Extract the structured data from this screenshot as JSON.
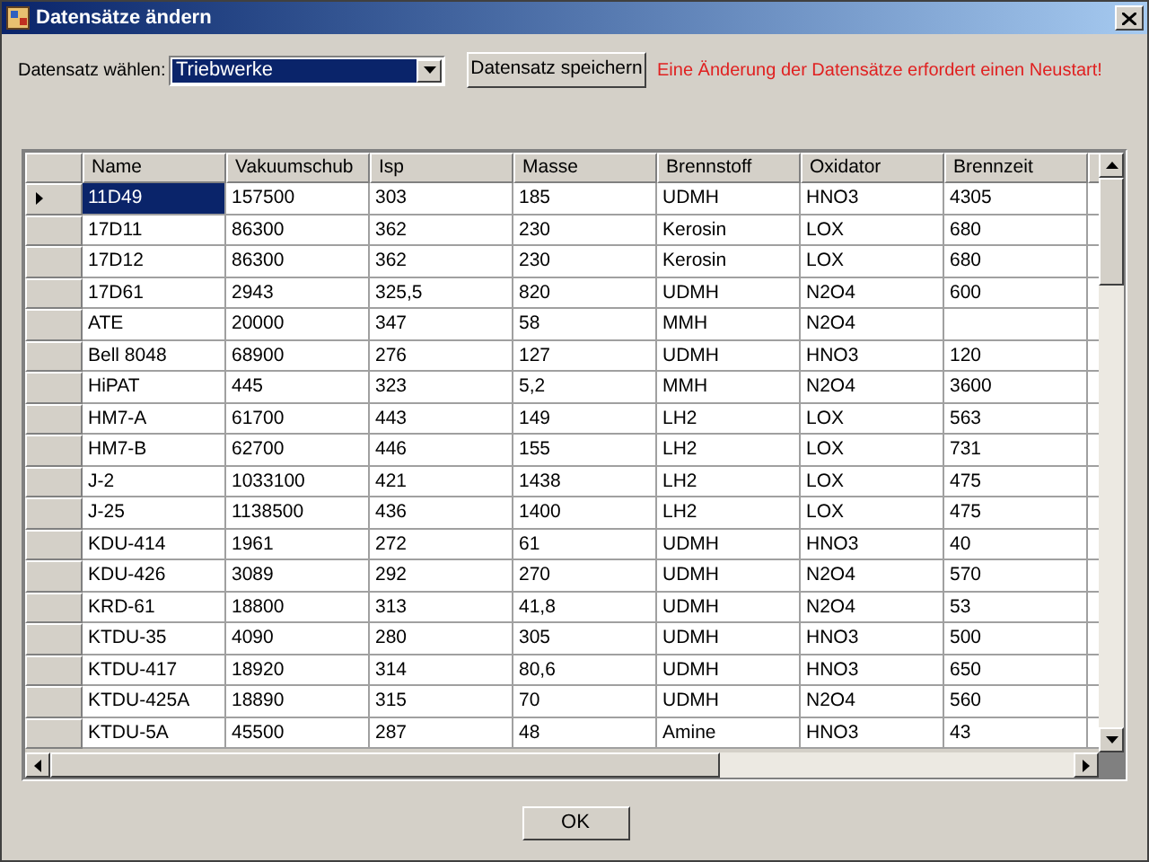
{
  "window": {
    "title": "Datensätze ändern"
  },
  "dataset_label": "Datensatz wählen:",
  "dataset_select": {
    "value": "Triebwerke"
  },
  "save_button": "Datensatz speichern",
  "warning": "Eine Änderung der Datensätze erfordert einen Neustart!",
  "table": {
    "columns": [
      "Name",
      "Vakuumschub",
      "Isp",
      "Masse",
      "Brennstoff",
      "Oxidator",
      "Brennzeit"
    ],
    "rows": [
      {
        "selected": true,
        "cells": [
          "11D49",
          "157500",
          "303",
          "185",
          "UDMH",
          "HNO3",
          "4305"
        ]
      },
      {
        "selected": false,
        "cells": [
          "17D11",
          "86300",
          "362",
          "230",
          "Kerosin",
          "LOX",
          "680"
        ]
      },
      {
        "selected": false,
        "cells": [
          "17D12",
          "86300",
          "362",
          "230",
          "Kerosin",
          "LOX",
          "680"
        ]
      },
      {
        "selected": false,
        "cells": [
          "17D61",
          "2943",
          "325,5",
          "820",
          "UDMH",
          "N2O4",
          "600"
        ]
      },
      {
        "selected": false,
        "cells": [
          "ATE",
          "20000",
          "347",
          "58",
          "MMH",
          "N2O4",
          null
        ]
      },
      {
        "selected": false,
        "cells": [
          "Bell 8048",
          "68900",
          "276",
          "127",
          "UDMH",
          "HNO3",
          "120"
        ]
      },
      {
        "selected": false,
        "cells": [
          "HiPAT",
          "445",
          "323",
          "5,2",
          "MMH",
          "N2O4",
          "3600"
        ]
      },
      {
        "selected": false,
        "cells": [
          "HM7-A",
          "61700",
          "443",
          "149",
          "LH2",
          "LOX",
          "563"
        ]
      },
      {
        "selected": false,
        "cells": [
          "HM7-B",
          "62700",
          "446",
          "155",
          "LH2",
          "LOX",
          "731"
        ]
      },
      {
        "selected": false,
        "cells": [
          "J-2",
          "1033100",
          "421",
          "1438",
          "LH2",
          "LOX",
          "475"
        ]
      },
      {
        "selected": false,
        "cells": [
          "J-25",
          "1138500",
          "436",
          "1400",
          "LH2",
          "LOX",
          "475"
        ]
      },
      {
        "selected": false,
        "cells": [
          "KDU-414",
          "1961",
          "272",
          "61",
          "UDMH",
          "HNO3",
          "40"
        ]
      },
      {
        "selected": false,
        "cells": [
          "KDU-426",
          "3089",
          "292",
          "270",
          "UDMH",
          "N2O4",
          "570"
        ]
      },
      {
        "selected": false,
        "cells": [
          "KRD-61",
          "18800",
          "313",
          "41,8",
          "UDMH",
          "N2O4",
          "53"
        ]
      },
      {
        "selected": false,
        "cells": [
          "KTDU-35",
          "4090",
          "280",
          "305",
          "UDMH",
          "HNO3",
          "500"
        ]
      },
      {
        "selected": false,
        "cells": [
          "KTDU-417",
          "18920",
          "314",
          "80,6",
          "UDMH",
          "HNO3",
          "650"
        ]
      },
      {
        "selected": false,
        "cells": [
          "KTDU-425A",
          "18890",
          "315",
          "70",
          "UDMH",
          "N2O4",
          "560"
        ]
      },
      {
        "selected": false,
        "cells": [
          "KTDU-5A",
          "45500",
          "287",
          "48",
          "Amine",
          "HNO3",
          "43"
        ]
      }
    ]
  },
  "ok_button": "OK"
}
